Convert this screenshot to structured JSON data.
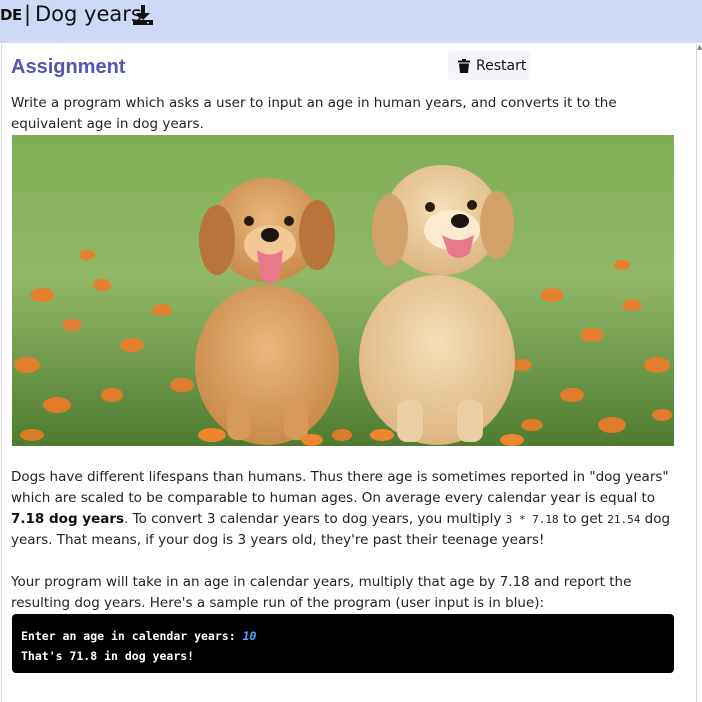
{
  "header": {
    "prefix": "DE",
    "separator": "|",
    "title": "Dog years"
  },
  "assignment": {
    "heading": "Assignment",
    "restart_label": "Restart"
  },
  "intro": "Write a program which asks a user to input an age in human years, and converts it to the equivalent age in dog years.",
  "image": {
    "description_icon": "puppies-photo"
  },
  "body": {
    "p1_a": "Dogs have different lifespans than humans. Thus there age is sometimes reported in \"dog years\" which are scaled to be comparable to human ages. On average every calendar year is equal to ",
    "p1_bold": "7.18 dog years",
    "p1_b": ". To convert 3 calendar years to dog years, you multiply ",
    "p1_code1": "3 * 7.18",
    "p1_c": " to get ",
    "p1_code2": "21.54",
    "p1_d": " dog years. That means, if your dog is 3 years old, they're past their teenage years!",
    "p2": "Your program will take in an age in calendar years, multiply that age by 7.18 and report the resulting dog years. Here's a sample run of the program (user input is in blue):"
  },
  "terminal": {
    "line1_prompt": "Enter an age in calendar years: ",
    "line1_input": "10",
    "line2": "That's 71.8 in dog years!"
  },
  "colors": {
    "topbar": "#cdd9f6",
    "heading": "#5553b6",
    "terminal_bg": "#000000",
    "input_blue": "#4aa7ff"
  }
}
